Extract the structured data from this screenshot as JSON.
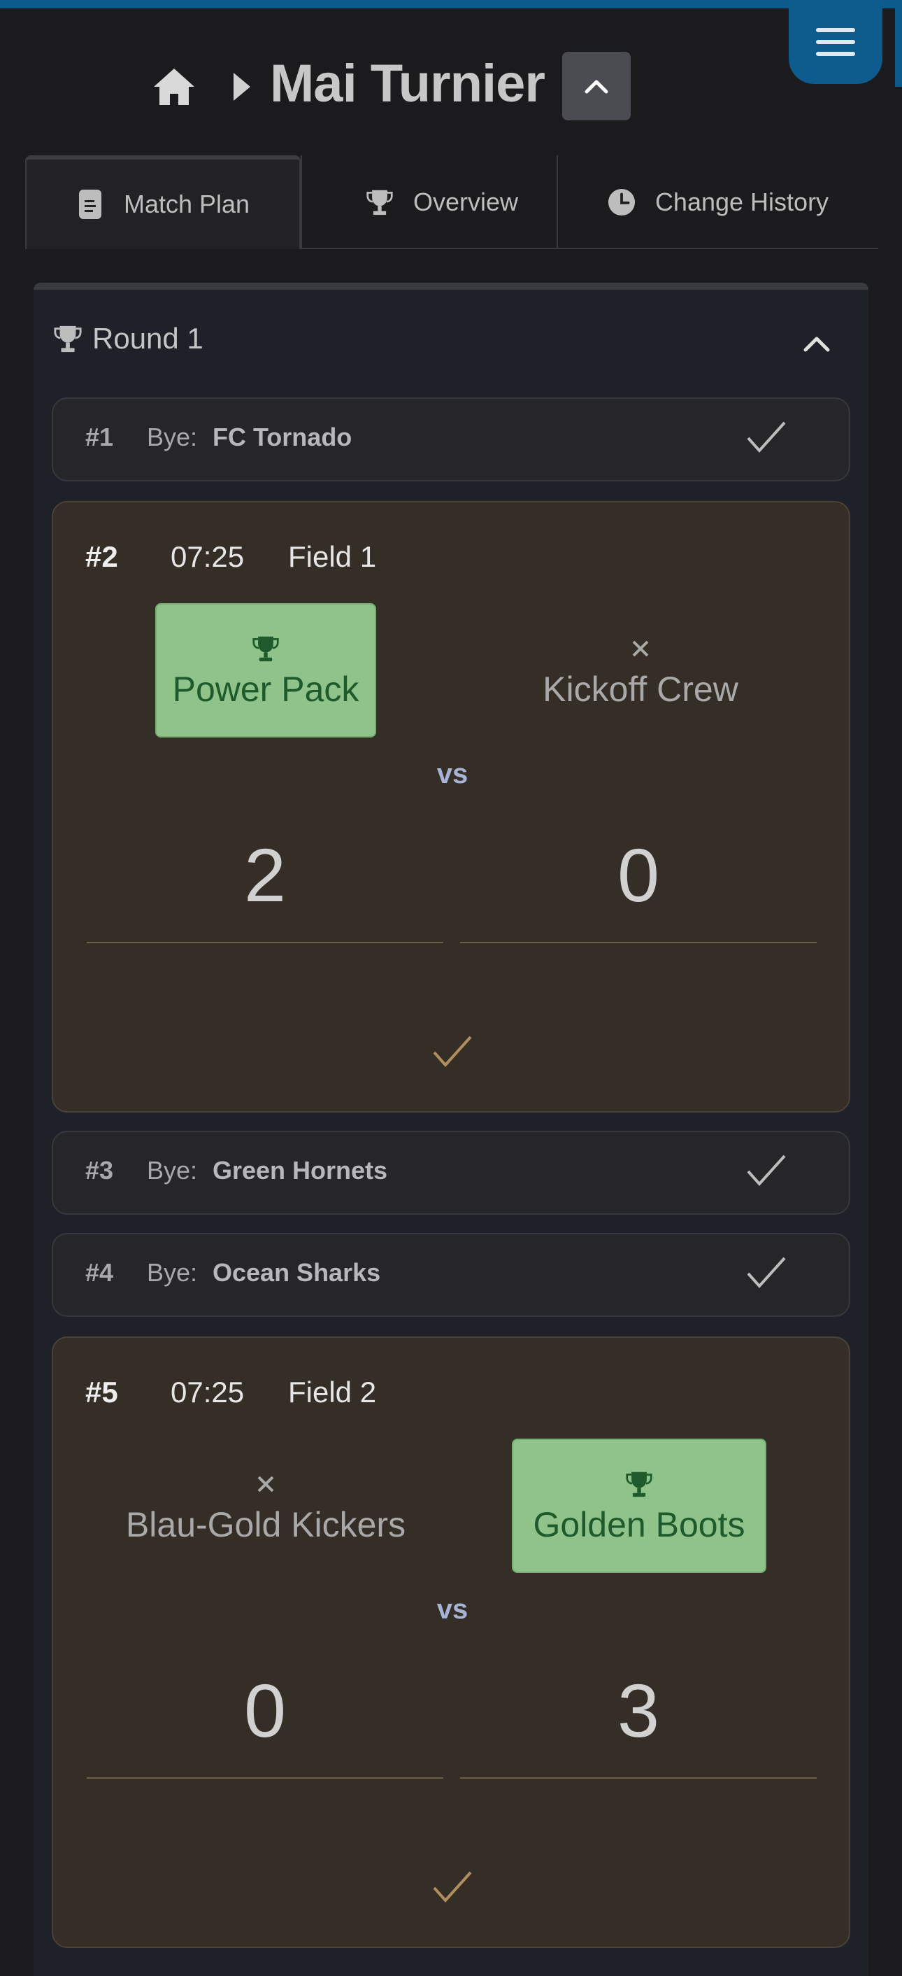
{
  "header": {
    "title": "Mai Turnier"
  },
  "tabs": [
    {
      "label": "Match Plan",
      "icon": "document-icon",
      "active": true
    },
    {
      "label": "Overview",
      "icon": "trophy-icon",
      "active": false
    },
    {
      "label": "Change History",
      "icon": "clock-icon",
      "active": false
    }
  ],
  "round": {
    "label": "Round 1"
  },
  "matches": {
    "m1": {
      "number": "#1",
      "bye_label": "Bye:",
      "team": "FC Tornado"
    },
    "m2": {
      "number": "#2",
      "time": "07:25",
      "field": "Field 1",
      "home": "Power Pack",
      "away": "Kickoff Crew",
      "vs": "vs",
      "home_score": "2",
      "away_score": "0"
    },
    "m3": {
      "number": "#3",
      "bye_label": "Bye:",
      "team": "Green Hornets"
    },
    "m4": {
      "number": "#4",
      "bye_label": "Bye:",
      "team": "Ocean Sharks"
    },
    "m5": {
      "number": "#5",
      "time": "07:25",
      "field": "Field 2",
      "home": "Blau-Gold Kickers",
      "away": "Golden Boots",
      "vs": "vs",
      "home_score": "0",
      "away_score": "3"
    }
  },
  "colors": {
    "accent": "#0e5b8d",
    "winner_bg": "#8fc38a",
    "winner_text": "#1e5a2c",
    "match_bg": "#342e27"
  }
}
